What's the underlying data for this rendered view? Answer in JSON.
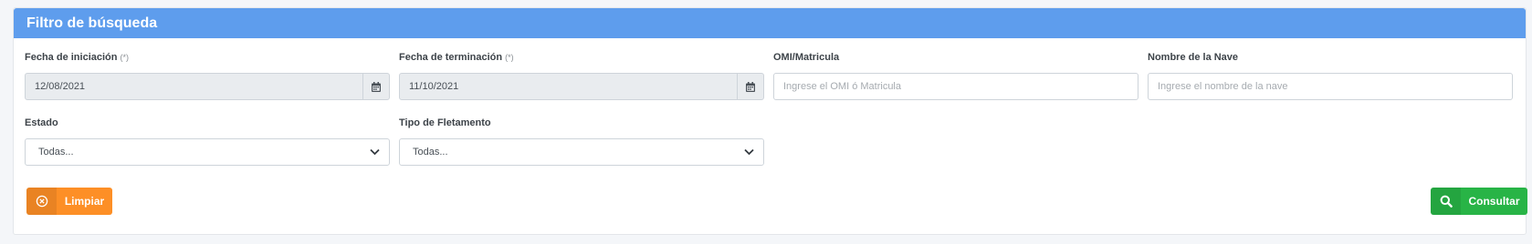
{
  "card": {
    "title": "Filtro de búsqueda"
  },
  "fields": {
    "start_date": {
      "label": "Fecha de iniciación",
      "required_mark": "(*)",
      "value": "12/08/2021"
    },
    "end_date": {
      "label": "Fecha de terminación",
      "required_mark": "(*)",
      "value": "11/10/2021"
    },
    "omi": {
      "label": "OMI/Matricula",
      "placeholder": "Ingrese el OMI ó Matricula"
    },
    "ship_name": {
      "label": "Nombre de la Nave",
      "placeholder": "Ingrese el nombre de la nave"
    },
    "status": {
      "label": "Estado",
      "selected": "Todas..."
    },
    "charter_type": {
      "label": "Tipo de Fletamento",
      "selected": "Todas..."
    }
  },
  "buttons": {
    "clear": {
      "label": "Limpiar",
      "icon": "circle-x-icon"
    },
    "search": {
      "label": "Consultar",
      "icon": "search-icon"
    }
  },
  "colors": {
    "header": "#5e9ded",
    "clear_button": "#fd8f26",
    "search_button": "#28b446"
  }
}
